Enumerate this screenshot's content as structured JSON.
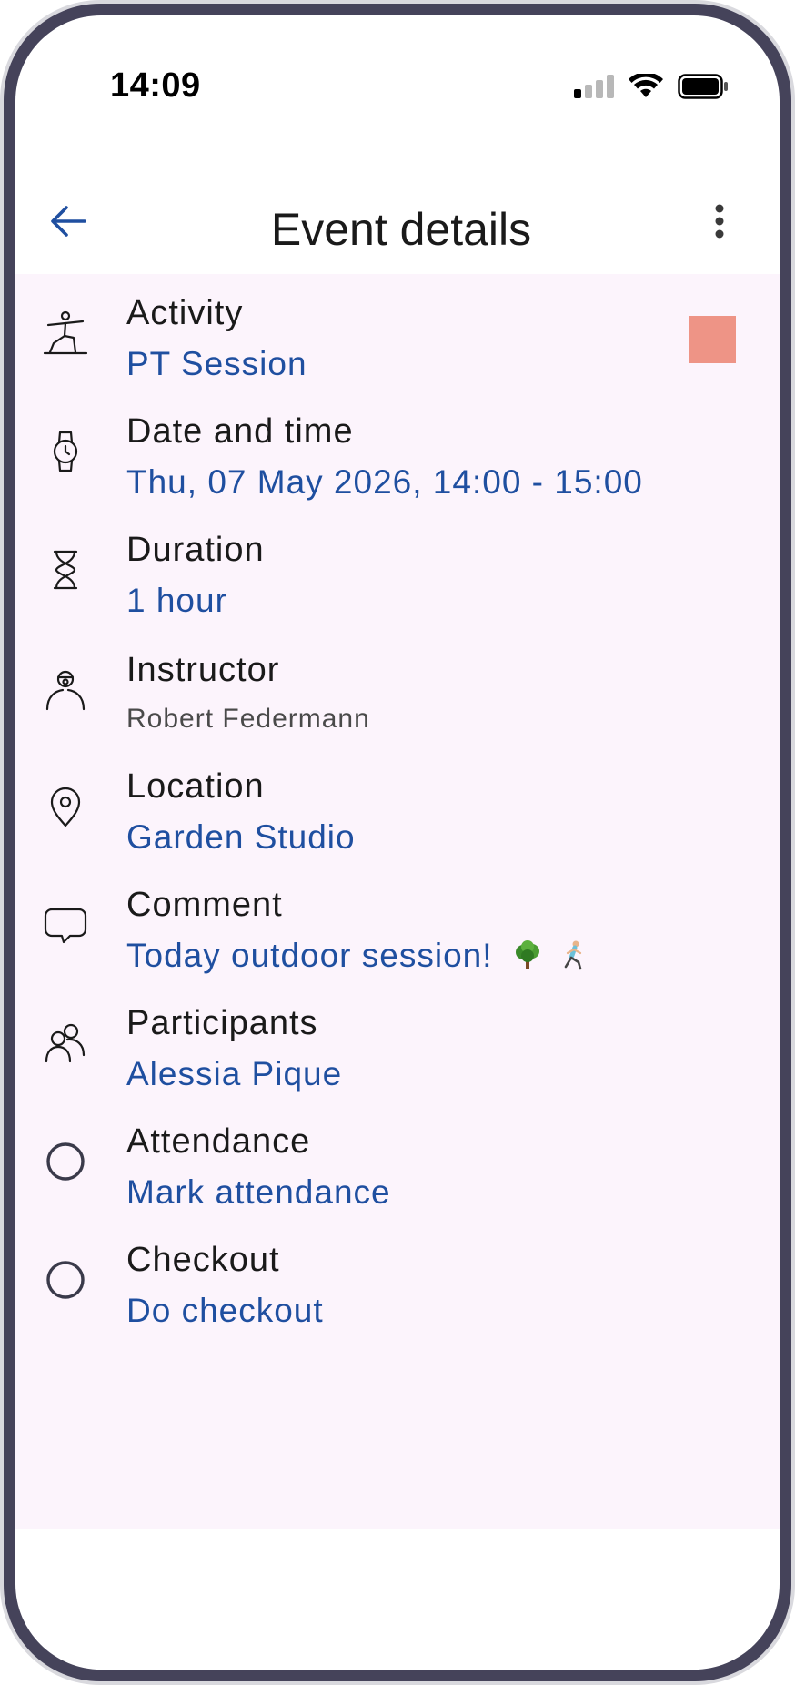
{
  "status_bar": {
    "time": "14:09",
    "icons": [
      "cellular-signal-icon",
      "wifi-icon",
      "battery-icon"
    ]
  },
  "app_bar": {
    "title": "Event details",
    "back_icon": "arrow-left-icon",
    "menu_icon": "more-vertical-icon"
  },
  "colors": {
    "accent": "#1f4fa0",
    "content_background": "#fcf4fc",
    "activity_color": "#ee9486"
  },
  "details": [
    {
      "label": "Activity",
      "value": "PT Session",
      "icon": "yoga-pose-icon"
    },
    {
      "label": "Date and time",
      "value": "Thu, 07 May 2026, 14:00 - 15:00",
      "icon": "watch-icon"
    },
    {
      "label": "Duration",
      "value": "1 hour",
      "icon": "hourglass-icon"
    },
    {
      "label": "Instructor",
      "value": "Robert Federmann",
      "icon": "instructor-icon"
    },
    {
      "label": "Location",
      "value": "Garden Studio",
      "icon": "location-pin-icon"
    },
    {
      "label": "Comment",
      "value": "Today outdoor session!",
      "icon": "comment-bubble-icon",
      "emojis": [
        "tree-emoji",
        "runner-emoji"
      ]
    },
    {
      "label": "Participants",
      "value": "Alessia Pique",
      "icon": "people-icon"
    },
    {
      "label": "Attendance",
      "value": "Mark attendance",
      "icon": "empty-circle-icon"
    },
    {
      "label": "Checkout",
      "value": "Do checkout",
      "icon": "empty-circle-icon"
    }
  ]
}
